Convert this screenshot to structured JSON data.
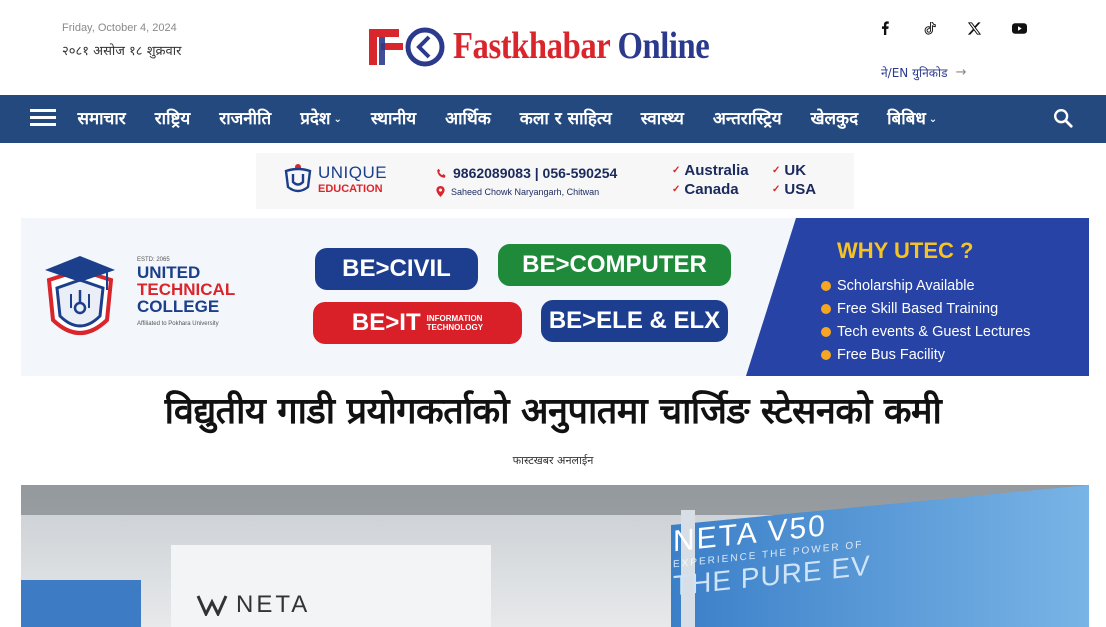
{
  "header": {
    "date_en": "Friday, October 4, 2024",
    "date_np": "२०८१ असोज १८ शुक्रवार",
    "logo": {
      "brand_red": "Fastkhabar",
      "brand_blue": "Online",
      "colors": {
        "red": "#d9262c",
        "blue": "#2b3a8c"
      }
    },
    "socials": [
      "facebook-icon",
      "tiktok-icon",
      "x-icon",
      "youtube-icon"
    ],
    "lang_toggle": "ने/EN युनिकोड",
    "lang_arrow": "→"
  },
  "nav": {
    "background": "#24497f",
    "items": [
      {
        "label": "समाचार",
        "dropdown": false
      },
      {
        "label": "राष्ट्रिय",
        "dropdown": false
      },
      {
        "label": "राजनीति",
        "dropdown": false
      },
      {
        "label": "प्रदेश",
        "dropdown": true
      },
      {
        "label": "स्थानीय",
        "dropdown": false
      },
      {
        "label": "आर्थिक",
        "dropdown": false
      },
      {
        "label": "कला र साहित्य",
        "dropdown": false
      },
      {
        "label": "स्वास्थ्य",
        "dropdown": false
      },
      {
        "label": "अन्तरास्ट्रिय",
        "dropdown": false
      },
      {
        "label": "खेलकुद",
        "dropdown": false
      },
      {
        "label": "बिबिध",
        "dropdown": true
      }
    ],
    "chevron": "⌄"
  },
  "ad_unique": {
    "brand_line1": "UNIQUE",
    "brand_line2": "EDUCATION",
    "phone": "9862089083 | 056-590254",
    "address": "Saheed Chowk Naryangarh, Chitwan",
    "countries": [
      "Australia",
      "UK",
      "Canada",
      "USA"
    ],
    "tick": "✓"
  },
  "ad_utec": {
    "est": "ESTD: 2065",
    "name_line1": "UNITED",
    "name_line2": "TECHNICAL",
    "name_line3": "COLLEGE",
    "affiliation": "Affiliated to Pokhara University",
    "programs": {
      "civil": "BE>CIVIL",
      "computer": "BE>COMPUTER",
      "it": "BE>IT",
      "it_sub1": "INFORMATION",
      "it_sub2": "TECHNOLOGY",
      "ele": "BE>ELE & ELX"
    },
    "why_title": "WHY UTEC ?",
    "why_points": [
      "Scholarship Available",
      "Free Skill Based Training",
      "Tech events & Guest Lectures",
      "Free Bus Facility"
    ]
  },
  "article": {
    "headline": "विद्युतीय गाडी प्रयोगकर्ताको अनुपातमा चार्जिङ स्टेसनको कमी",
    "author": "फास्टखबर अनलाईन",
    "hero_signage": {
      "main": "NETA V50",
      "tagline": "EXPERIENCE THE POWER OF",
      "sub": "THE PURE EV",
      "brand": "NETA"
    }
  }
}
